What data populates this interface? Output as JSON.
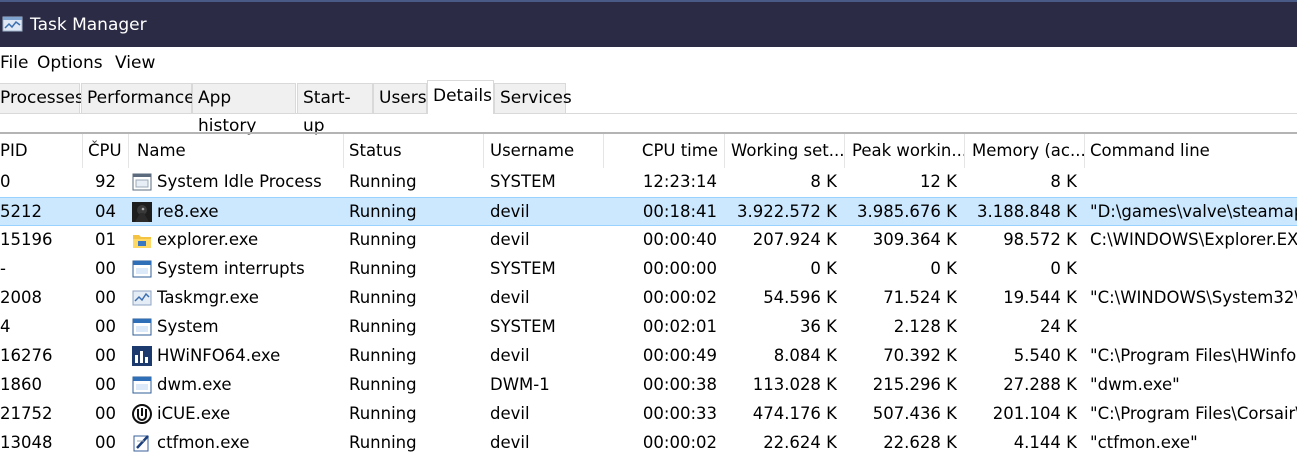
{
  "window": {
    "title": "Task Manager",
    "icon": "task-manager-icon"
  },
  "menu": [
    "File",
    "Options",
    "View"
  ],
  "tabs": [
    {
      "label": "Processes"
    },
    {
      "label": "Performance"
    },
    {
      "label": "App history"
    },
    {
      "label": "Start-up"
    },
    {
      "label": "Users"
    },
    {
      "label": "Details",
      "active": true
    },
    {
      "label": "Services"
    }
  ],
  "columns": {
    "pid": "PID",
    "cpu": "CPU",
    "name": "Name",
    "status": "Status",
    "username": "Username",
    "cpu_time": "CPU time",
    "working_set": "Working set...",
    "peak_working": "Peak workin...",
    "memory": "Memory (ac...",
    "command_line": "Command line"
  },
  "sort": {
    "column": "cpu",
    "direction": "descending"
  },
  "processes": [
    {
      "pid": "0",
      "cpu": "92",
      "name": "System Idle Process",
      "status": "Running",
      "username": "SYSTEM",
      "cpu_time": "12:23:14",
      "working_set": "8 K",
      "peak_working": "12 K",
      "memory": "8 K",
      "command_line": "",
      "icon": "system-idle-icon"
    },
    {
      "pid": "5212",
      "cpu": "04",
      "name": "re8.exe",
      "status": "Running",
      "username": "devil",
      "cpu_time": "00:18:41",
      "working_set": "3.922.572 K",
      "peak_working": "3.985.676 K",
      "memory": "3.188.848 K",
      "command_line": "\"D:\\games\\valve\\steamap",
      "icon": "re8-icon",
      "selected": true
    },
    {
      "pid": "15196",
      "cpu": "01",
      "name": "explorer.exe",
      "status": "Running",
      "username": "devil",
      "cpu_time": "00:00:40",
      "working_set": "207.924 K",
      "peak_working": "309.364 K",
      "memory": "98.572 K",
      "command_line": "C:\\WINDOWS\\Explorer.EX",
      "icon": "folder-icon"
    },
    {
      "pid": "-",
      "cpu": "00",
      "name": "System interrupts",
      "status": "Running",
      "username": "SYSTEM",
      "cpu_time": "00:00:00",
      "working_set": "0 K",
      "peak_working": "0 K",
      "memory": "0 K",
      "command_line": "",
      "icon": "system-window-icon"
    },
    {
      "pid": "2008",
      "cpu": "00",
      "name": "Taskmgr.exe",
      "status": "Running",
      "username": "devil",
      "cpu_time": "00:00:02",
      "working_set": "54.596 K",
      "peak_working": "71.524 K",
      "memory": "19.544 K",
      "command_line": "\"C:\\WINDOWS\\System32\\",
      "icon": "task-manager-icon"
    },
    {
      "pid": "4",
      "cpu": "00",
      "name": "System",
      "status": "Running",
      "username": "SYSTEM",
      "cpu_time": "00:02:01",
      "working_set": "36 K",
      "peak_working": "2.128 K",
      "memory": "24 K",
      "command_line": "",
      "icon": "system-window-icon"
    },
    {
      "pid": "16276",
      "cpu": "00",
      "name": "HWiNFO64.exe",
      "status": "Running",
      "username": "devil",
      "cpu_time": "00:00:49",
      "working_set": "8.084 K",
      "peak_working": "70.392 K",
      "memory": "5.540 K",
      "command_line": "\"C:\\Program Files\\HWinfo",
      "icon": "hwinfo-icon"
    },
    {
      "pid": "1860",
      "cpu": "00",
      "name": "dwm.exe",
      "status": "Running",
      "username": "DWM-1",
      "cpu_time": "00:00:38",
      "working_set": "113.028 K",
      "peak_working": "215.296 K",
      "memory": "27.288 K",
      "command_line": "\"dwm.exe\"",
      "icon": "system-window-icon"
    },
    {
      "pid": "21752",
      "cpu": "00",
      "name": "iCUE.exe",
      "status": "Running",
      "username": "devil",
      "cpu_time": "00:00:33",
      "working_set": "474.176 K",
      "peak_working": "507.436 K",
      "memory": "201.104 K",
      "command_line": "\"C:\\Program Files\\Corsair\\",
      "icon": "icue-icon"
    },
    {
      "pid": "13048",
      "cpu": "00",
      "name": "ctfmon.exe",
      "status": "Running",
      "username": "devil",
      "cpu_time": "00:00:02",
      "working_set": "22.624 K",
      "peak_working": "22.628 K",
      "memory": "4.144 K",
      "command_line": "\"ctfmon.exe\"",
      "icon": "ctfmon-icon"
    }
  ]
}
